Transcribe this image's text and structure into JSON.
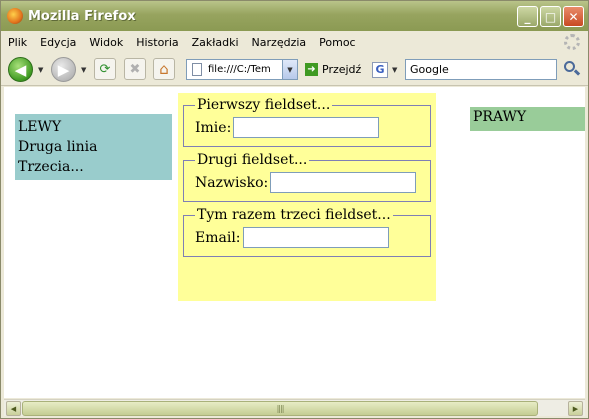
{
  "window": {
    "title": "Mozilla Firefox"
  },
  "titlebar_buttons": {
    "minimize": "_",
    "maximize": "□",
    "close": "✕"
  },
  "menu": [
    "Plik",
    "Edycja",
    "Widok",
    "Historia",
    "Zakładki",
    "Narzędzia",
    "Pomoc"
  ],
  "toolbar": {
    "url": "file:///C:/Tem",
    "go_label": "Przejdź",
    "search_engine": "G",
    "search_value": "Google",
    "icons": [
      "back-arrow",
      "forward-arrow",
      "reload",
      "stop",
      "home",
      "page",
      "go-arrow",
      "search-magnifier"
    ]
  },
  "page": {
    "left_box": {
      "lines": [
        "LEWY",
        "Druga linia",
        "Trzecia..."
      ]
    },
    "right_box": {
      "text": "PRAWY"
    },
    "fieldsets": [
      {
        "legend": "Pierwszy fieldset...",
        "label": "Imie:",
        "value": ""
      },
      {
        "legend": "Drugi fieldset...",
        "label": "Nazwisko:",
        "value": ""
      },
      {
        "legend": "Tym razem trzeci fieldset...",
        "label": "Email:",
        "value": ""
      }
    ]
  },
  "colors": {
    "left_bg": "#99cccc",
    "center_bg": "#ffff99",
    "right_bg": "#99cc99",
    "titlebar": "#97a45f"
  },
  "scrollbar": {
    "grip": "||||"
  }
}
